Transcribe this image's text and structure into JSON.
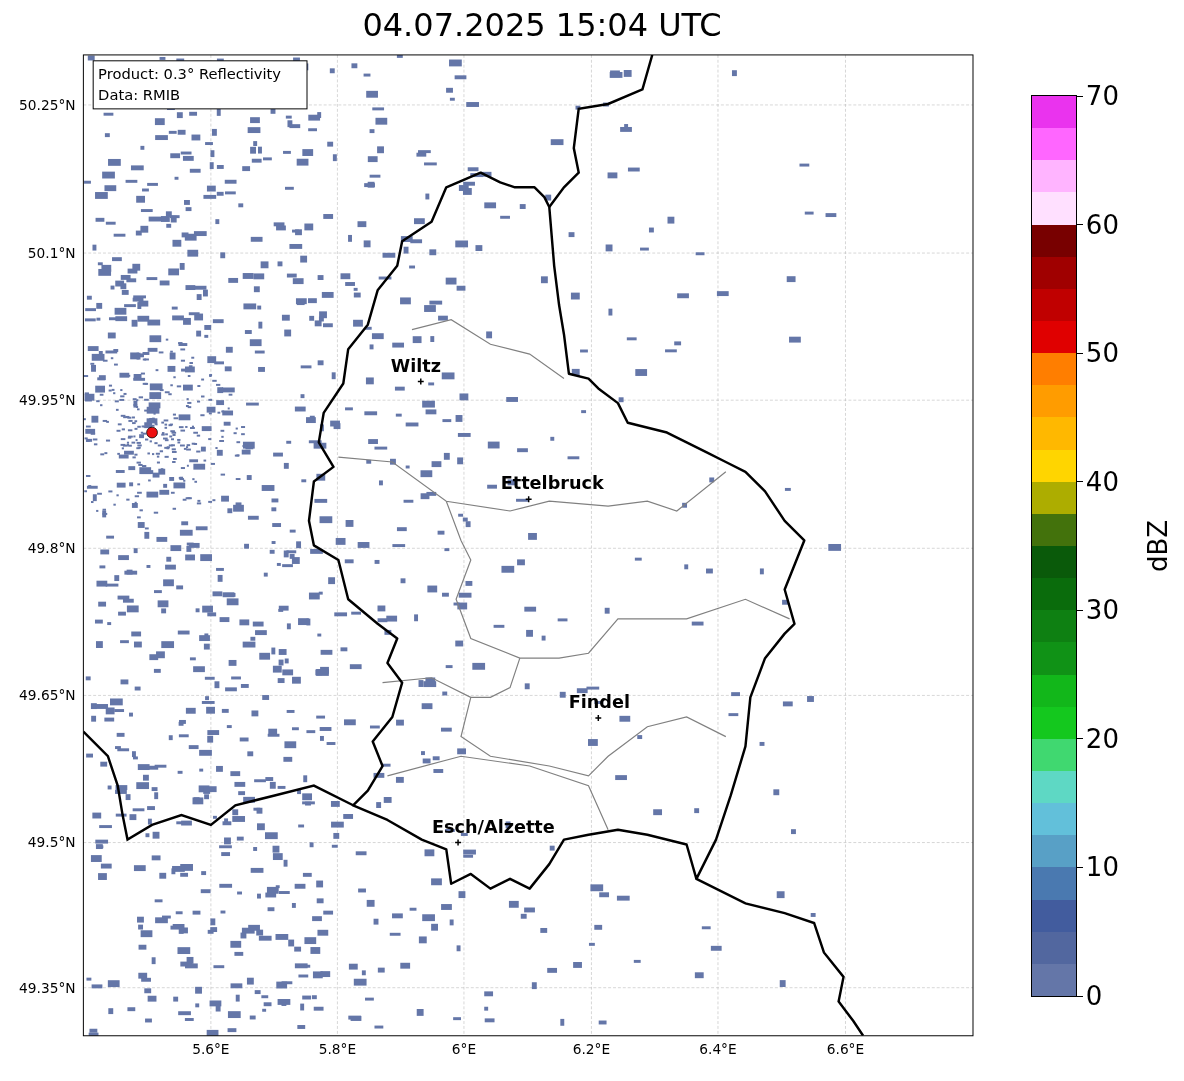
{
  "title": "04.07.2025 15:04 UTC",
  "map": {
    "info_lines": [
      "Product: 0.3° Reflectivity",
      "Data: RMIB"
    ],
    "lat_labels": [
      "50.25°N",
      "50.1°N",
      "49.95°N",
      "49.8°N",
      "49.65°N",
      "49.5°N",
      "49.35°N"
    ],
    "lon_labels": [
      "5.6°E",
      "5.8°E",
      "6°E",
      "6.2°E",
      "6.4°E",
      "6.6°E"
    ],
    "cities": [
      {
        "name": "Wiltz"
      },
      {
        "name": "Ettelbruck"
      },
      {
        "name": "Findel"
      },
      {
        "name": "Esch/Alzette"
      }
    ]
  },
  "colorbar": {
    "label": "dBZ",
    "ticks": [
      "70",
      "60",
      "50",
      "40",
      "30",
      "20",
      "10",
      "0"
    ],
    "steps": [
      {
        "color": "#ea33ee"
      },
      {
        "color": "#ff66ff"
      },
      {
        "color": "#ffb4ff"
      },
      {
        "color": "#ffe0ff"
      },
      {
        "color": "#780000"
      },
      {
        "color": "#a00000"
      },
      {
        "color": "#c00000"
      },
      {
        "color": "#e00000"
      },
      {
        "color": "#ff7e00"
      },
      {
        "color": "#ff9c00"
      },
      {
        "color": "#ffb800"
      },
      {
        "color": "#ffd500"
      },
      {
        "color": "#adad00"
      },
      {
        "color": "#43720c"
      },
      {
        "color": "#0a5a0a"
      },
      {
        "color": "#0a6c0c"
      },
      {
        "color": "#0e8012"
      },
      {
        "color": "#109216"
      },
      {
        "color": "#12b71a"
      },
      {
        "color": "#14c81e"
      },
      {
        "color": "#40d870"
      },
      {
        "color": "#5ed8c4"
      },
      {
        "color": "#62c0da"
      },
      {
        "color": "#58a0c6"
      },
      {
        "color": "#4a79b0"
      },
      {
        "color": "#425c9e"
      },
      {
        "color": "#52679f"
      },
      {
        "color": "#6476a8"
      }
    ]
  }
}
